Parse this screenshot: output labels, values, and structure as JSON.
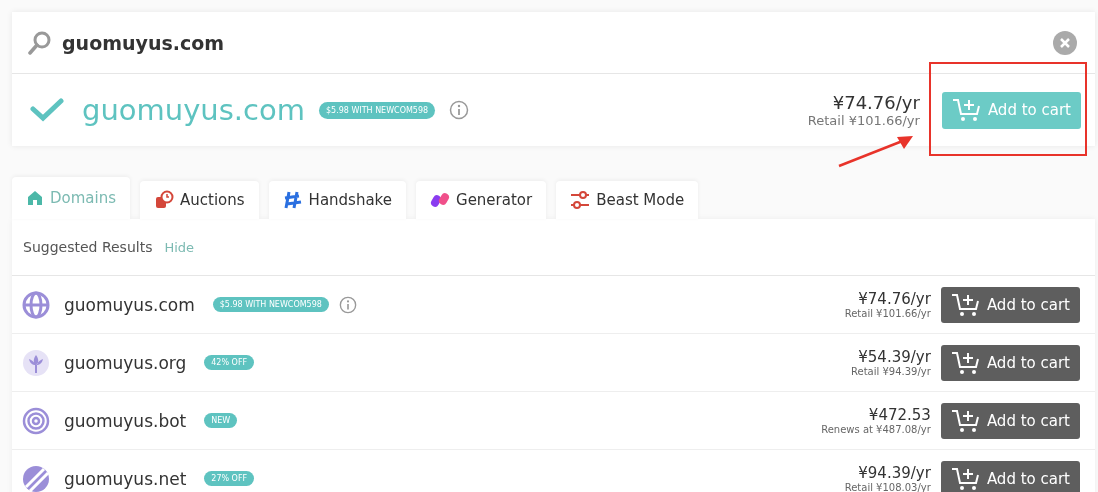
{
  "search": {
    "value": "guomuyus.com"
  },
  "featured": {
    "domain": "guomuyus.com",
    "available": true,
    "badge": "$5.98 WITH NEWCOM598",
    "price": "¥74.76/yr",
    "retail": "Retail ¥101.66/yr",
    "button": "Add to cart"
  },
  "tabs": [
    {
      "label": "Domains",
      "selected": true
    },
    {
      "label": "Auctions",
      "selected": false
    },
    {
      "label": "Handshake",
      "selected": false
    },
    {
      "label": "Generator",
      "selected": false
    },
    {
      "label": "Beast Mode",
      "selected": false
    }
  ],
  "suggested": {
    "title": "Suggested Results",
    "toggle": "Hide"
  },
  "results": [
    {
      "domain": "guomuyus.com",
      "badge": "$5.98 WITH NEWCOM598",
      "info": true,
      "price": "¥74.76/yr",
      "note": "Retail ¥101.66/yr",
      "button": "Add to cart"
    },
    {
      "domain": "guomuyus.org",
      "badge": "42% OFF",
      "info": false,
      "price": "¥54.39/yr",
      "note": "Retail ¥94.39/yr",
      "button": "Add to cart"
    },
    {
      "domain": "guomuyus.bot",
      "badge": "NEW",
      "info": false,
      "price": "¥472.53",
      "note": "Renews at ¥487.08/yr",
      "button": "Add to cart"
    },
    {
      "domain": "guomuyus.net",
      "badge": "27% OFF",
      "info": false,
      "price": "¥94.39/yr",
      "note": "Retail ¥108.03/yr",
      "button": "Add to cart"
    }
  ]
}
